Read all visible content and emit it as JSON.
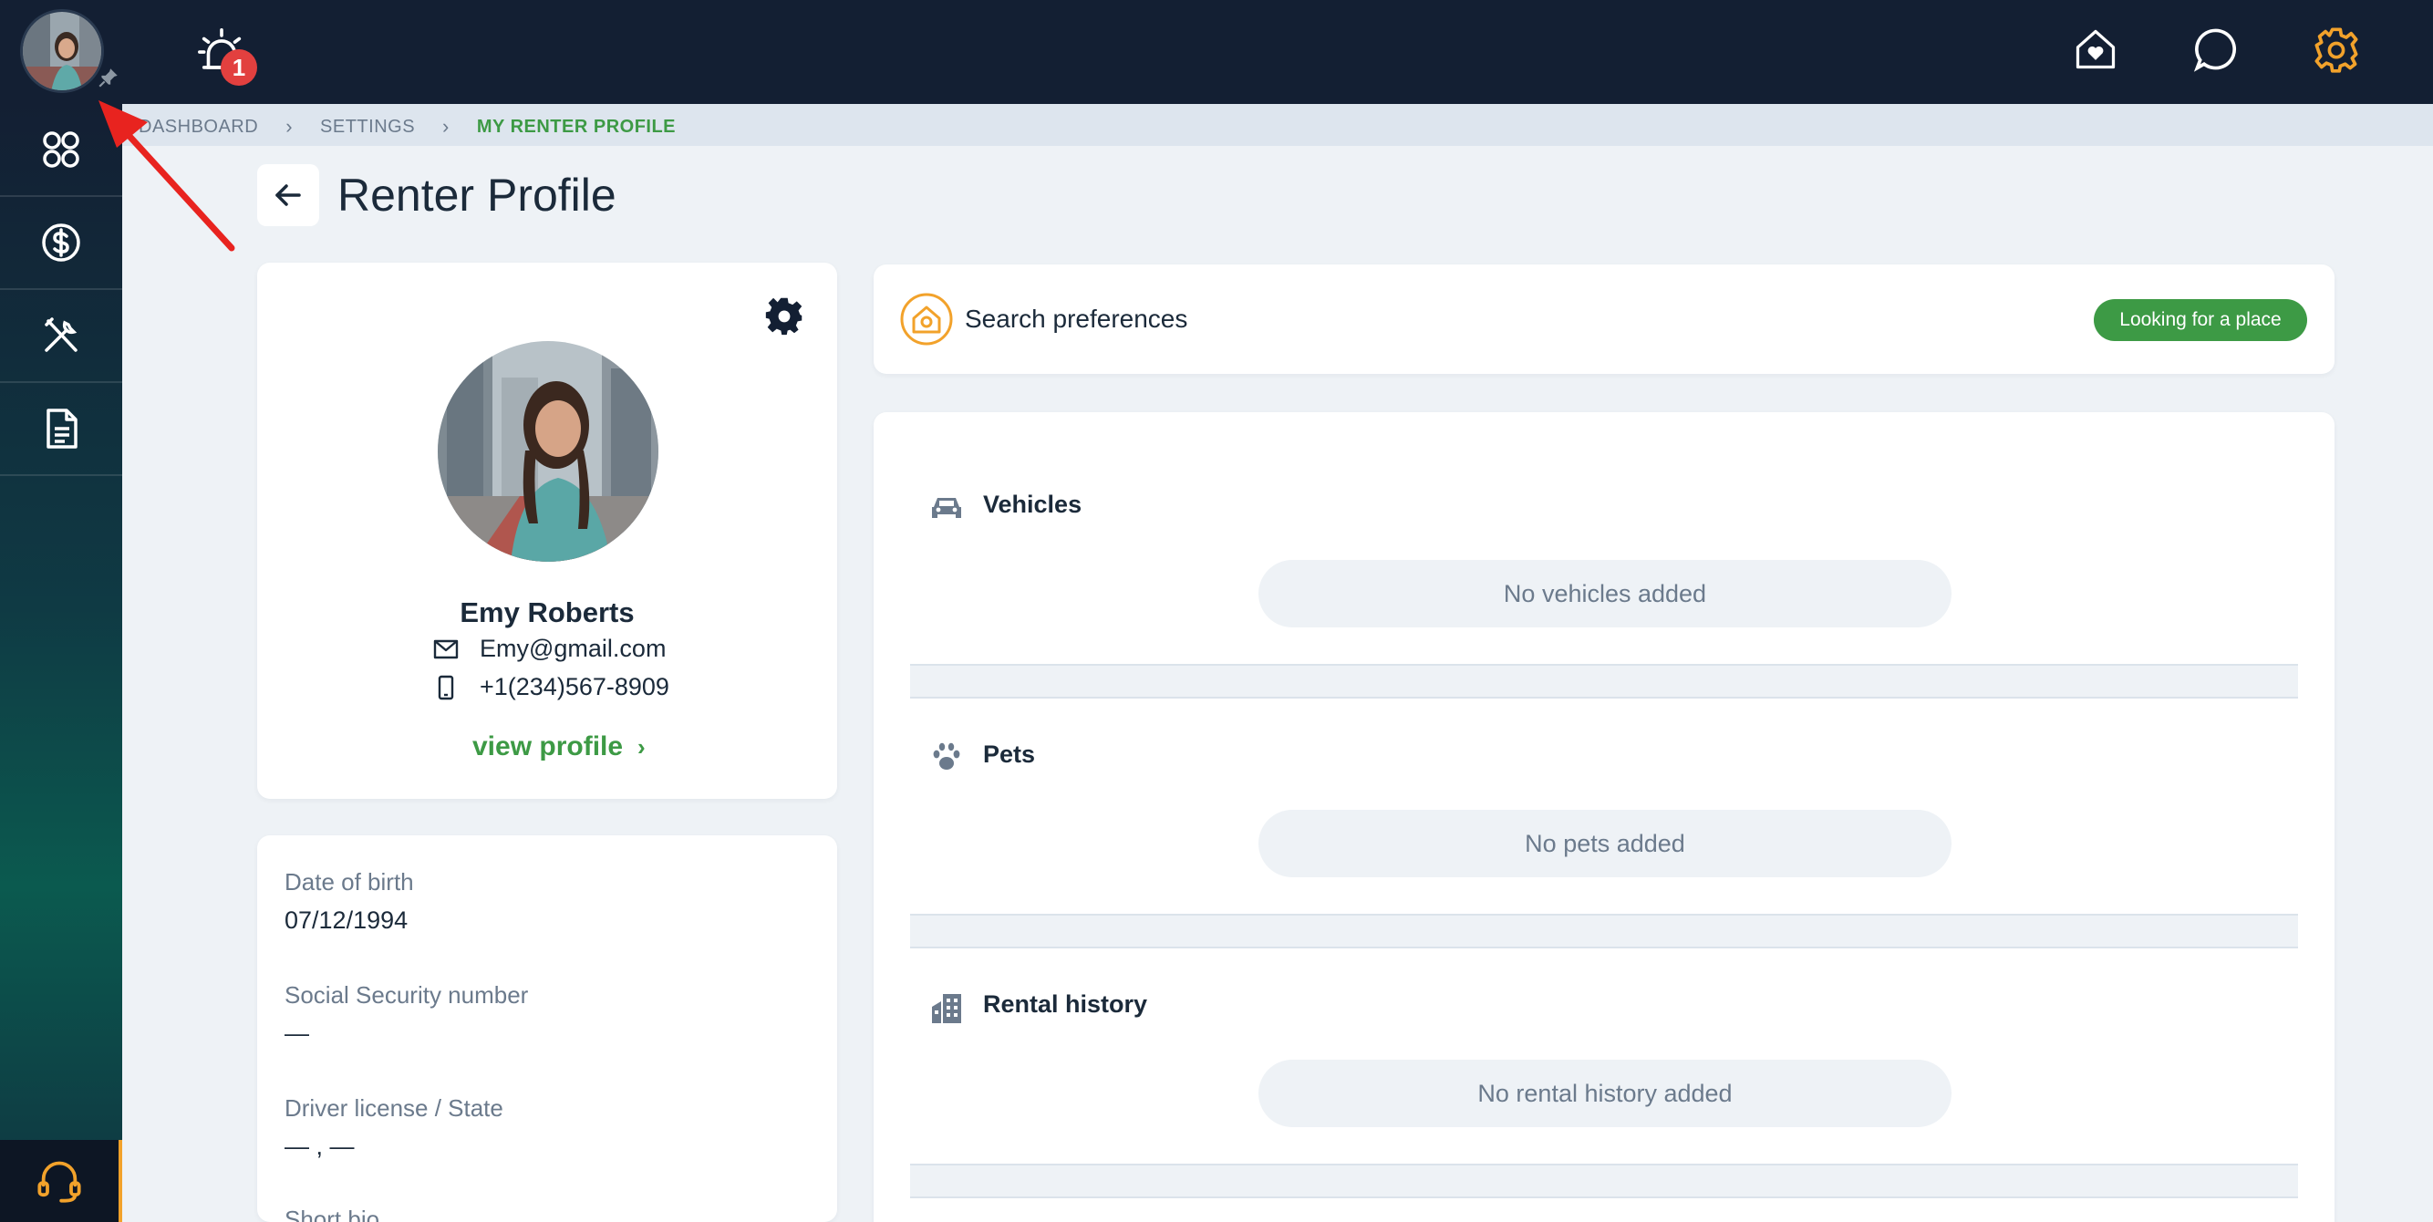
{
  "topbar": {
    "notification_count": "1",
    "icons": [
      "avatar",
      "pin-icon",
      "alarm-icon",
      "home-heart-icon",
      "chat-icon",
      "gear-icon"
    ]
  },
  "sidebar": {
    "items": [
      {
        "icon": "apps-grid-icon"
      },
      {
        "icon": "dollar-circle-icon"
      },
      {
        "icon": "tools-icon"
      },
      {
        "icon": "document-icon"
      }
    ],
    "support_icon": "headset-icon"
  },
  "breadcrumb": {
    "items": [
      "DASHBOARD",
      "SETTINGS",
      "MY RENTER PROFILE"
    ]
  },
  "page": {
    "title": "Renter Profile"
  },
  "profile": {
    "name": "Emy Roberts",
    "email": "Emy@gmail.com",
    "phone": "+1(234)567-8909",
    "view_profile_label": "view profile"
  },
  "details": {
    "dob_label": "Date of birth",
    "dob_value": "07/12/1994",
    "ssn_label": "Social Security number",
    "ssn_value": "—",
    "license_label": "Driver license / State",
    "license_value": "— , —",
    "bio_label": "Short bio"
  },
  "search_preferences": {
    "label": "Search preferences",
    "status": "Looking for a place"
  },
  "sections": [
    {
      "title": "Vehicles",
      "empty": "No vehicles added",
      "icon": "car-icon"
    },
    {
      "title": "Pets",
      "empty": "No pets added",
      "icon": "paw-icon"
    },
    {
      "title": "Rental history",
      "empty": "No rental history added",
      "icon": "building-icon"
    }
  ],
  "colors": {
    "topbar": "#131f33",
    "accent_green": "#3d9a45",
    "accent_orange": "#f2a22b",
    "badge_red": "#e2403f",
    "annotation_red": "#e8231f"
  }
}
